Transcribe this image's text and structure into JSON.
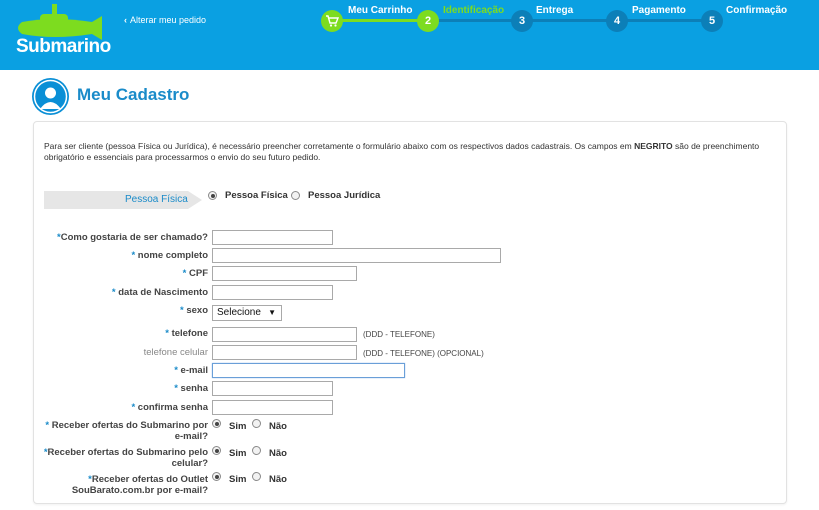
{
  "header": {
    "brand": "Submarino",
    "back_link": "Alterar meu pedido",
    "steps": [
      {
        "number": "",
        "label": "Meu Carrinho",
        "state": "done"
      },
      {
        "number": "2",
        "label": "Identificação",
        "state": "current"
      },
      {
        "number": "3",
        "label": "Entrega",
        "state": "pending"
      },
      {
        "number": "4",
        "label": "Pagamento",
        "state": "pending"
      },
      {
        "number": "5",
        "label": "Confirmação",
        "state": "pending"
      }
    ]
  },
  "page": {
    "title": "Meu Cadastro",
    "intro_part1": "Para ser cliente (pessoa Física ou Jurídica), é necessário preencher corretamente o formulário abaixo com os respectivos dados cadastrais. Os campos em ",
    "intro_bold": "NEGRITO",
    "intro_part2": " são de preenchimento obrigatório e essenciais para processarmos o envio do seu futuro pedido."
  },
  "person_type": {
    "tab_label": "Pessoa Física",
    "options": [
      "Pessoa Física",
      "Pessoa Jurídica"
    ],
    "selected": "Pessoa Física"
  },
  "form": {
    "apelido_label": "Como gostaria de ser chamado?",
    "nome_label": "nome completo",
    "cpf_label": "CPF",
    "nascimento_label": "data de Nascimento",
    "sexo_label": "sexo",
    "sexo_value": "Selecione",
    "telefone_label": "telefone",
    "telefone_hint": "(DDD - TELEFONE)",
    "celular_label": "telefone celular",
    "celular_hint": "(DDD - TELEFONE) (OPCIONAL)",
    "email_label": "e-mail",
    "senha_label": "senha",
    "confirma_label": "confirma senha",
    "ofertas_submarino_email_label": "Receber ofertas do Submarino por e-mail?",
    "ofertas_submarino_celular_label": "Receber ofertas do Submarino pelo celular?",
    "ofertas_outlet_label": "Receber ofertas do Outlet SouBarato.com.br por e-mail?",
    "yes": "Sim",
    "no": "Não",
    "required_mark": "*"
  },
  "colors": {
    "header_bg": "#0aa0e2",
    "step_done": "#7ddc1f",
    "step_pending": "#0c7fb8",
    "title_blue": "#1a8bc9"
  }
}
